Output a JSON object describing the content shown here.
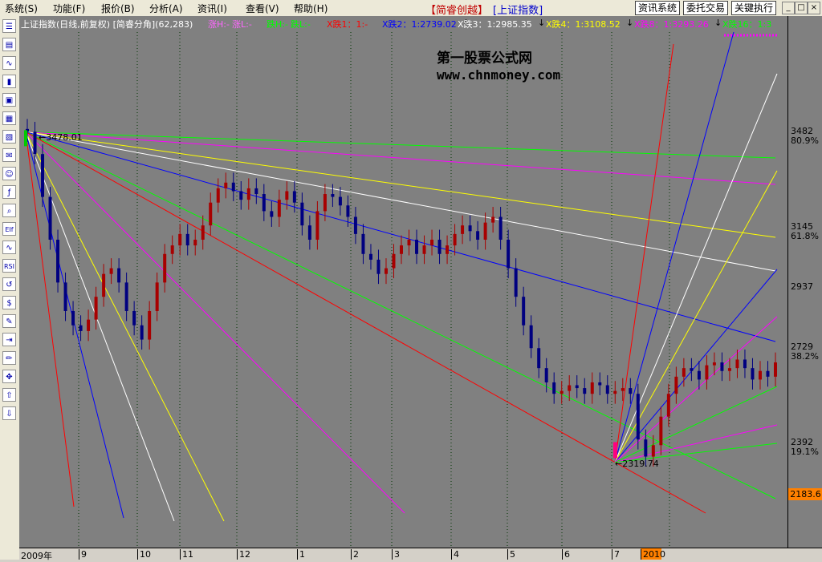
{
  "menu": [
    {
      "label": "系统(S)"
    },
    {
      "label": "功能(F)"
    },
    {
      "label": "报价(B)"
    },
    {
      "label": "分析(A)"
    },
    {
      "label": "资讯(I)"
    },
    {
      "label": "查看(V)"
    },
    {
      "label": "帮助(H)"
    }
  ],
  "app_title": "【简睿创越】",
  "index_title": "[上证指数]",
  "top_buttons": {
    "info_system": "资讯系统",
    "entrust_trade": "委托交易",
    "key_exec": "关键执行"
  },
  "window_controls": [
    "_",
    "□",
    "×"
  ],
  "chart_header": {
    "title": "上证指数(日线,前复权) [简睿分角](62,283)",
    "items": [
      {
        "text": "涨H:-",
        "color": "#ff66ff"
      },
      {
        "text": "涨L:-",
        "color": "#ff66ff"
      },
      {
        "text": "跌H:-",
        "color": "#00ff00"
      },
      {
        "text": "跌L:-",
        "color": "#00ff00"
      },
      {
        "text": "X跌1：1:-",
        "color": "#ff0000"
      },
      {
        "text": "X跌2：1:2739.02",
        "color": "#0000ff"
      },
      {
        "text": "X跌3：1:2985.35",
        "color": "#ffffff"
      },
      {
        "text": "X跌4：1:3108.52",
        "color": "#ffff00"
      },
      {
        "text": "X跌8：1:3293.26",
        "color": "#ff00ff"
      },
      {
        "text": "X跌16：1:3",
        "color": "#00ff00"
      }
    ],
    "arrow": "↓"
  },
  "watermark": {
    "name": "第一股票公式网",
    "url": "www.chnmoney.com"
  },
  "chart_labels": {
    "high_point": "3478.01",
    "low_point": "2319.74"
  },
  "right_axis": {
    "prices": [
      "3482",
      "3145",
      "2937",
      "2729",
      "2392"
    ],
    "percents": [
      "80.9%",
      "61.8%",
      "38.2%",
      "19.1%"
    ],
    "last_price": "2183.6"
  },
  "bottom_axis": {
    "dates": [
      "2009年",
      "9",
      "10",
      "11",
      "12",
      "1",
      "2",
      "3",
      "4",
      "5",
      "6",
      "7",
      "2010"
    ]
  },
  "left_toolbar": {
    "icons": [
      "quote-list-icon",
      "stock-list-icon",
      "line-chart-icon",
      "kline-chart-icon",
      "window-icon",
      "grid-icon",
      "report-icon",
      "mail-icon",
      "users-icon",
      "formula-icon",
      "search-icon",
      "ew-icon",
      "wave-icon",
      "rsi-icon",
      "history-icon",
      "money-icon",
      "tools-icon",
      "exit-icon",
      "pencil-icon",
      "move-icon",
      "up-arrow-icon",
      "down-arrow-icon"
    ],
    "glyphs": [
      "☰",
      "▤",
      "∿",
      "▮",
      "▣",
      "▦",
      "▧",
      "✉",
      "☺",
      "ƒ",
      "⌕",
      "EIf",
      "∿",
      "RSI",
      "↺",
      "$",
      "✎",
      "⇥",
      "✏",
      "✥",
      "⇧",
      "⇩"
    ]
  },
  "chart_data": {
    "type": "candlestick",
    "title": "上证指数(日线,前复权) [简睿分角](62,283)",
    "x_axis_labels": [
      "2009年",
      "9",
      "10",
      "11",
      "12",
      "1",
      "2",
      "3",
      "4",
      "5",
      "6",
      "7",
      "2010"
    ],
    "y_axis_labels": [
      3482,
      3145,
      2937,
      2729,
      2392
    ],
    "fibonacci_levels": [
      "80.9%",
      "61.8%",
      "38.2%",
      "19.1%"
    ],
    "annotations": [
      {
        "label": "3478.01",
        "role": "high"
      },
      {
        "label": "2319.74",
        "role": "low"
      }
    ],
    "last_price": 2183.6,
    "grid": true,
    "series": [
      {
        "role": "close",
        "values": [
          3478,
          3400,
          3250,
          3100,
          2950,
          2850,
          2800,
          2780,
          2820,
          2900,
          2980,
          3000,
          2950,
          2850,
          2800,
          2750,
          2850,
          2950,
          3050,
          3080,
          3120,
          3080,
          3100,
          3150,
          3230,
          3280,
          3300,
          3270,
          3240,
          3280,
          3260,
          3200,
          3180,
          3240,
          3270,
          3230,
          3150,
          3100,
          3200,
          3260,
          3250,
          3220,
          3180,
          3120,
          3050,
          3030,
          2980,
          3000,
          3050,
          3080,
          3100,
          3050,
          3080,
          3100,
          3050,
          3080,
          3120,
          3150,
          3130,
          3100,
          3160,
          3180,
          3100,
          3000,
          2900,
          2800,
          2720,
          2650,
          2600,
          2560,
          2570,
          2590,
          2580,
          2560,
          2600,
          2590,
          2560,
          2570,
          2580,
          2560,
          2400,
          2340,
          2380,
          2480,
          2560,
          2620,
          2650,
          2640,
          2610,
          2660,
          2670,
          2640,
          2650,
          2680,
          2650,
          2610,
          2640,
          2620,
          2670
        ]
      }
    ]
  }
}
